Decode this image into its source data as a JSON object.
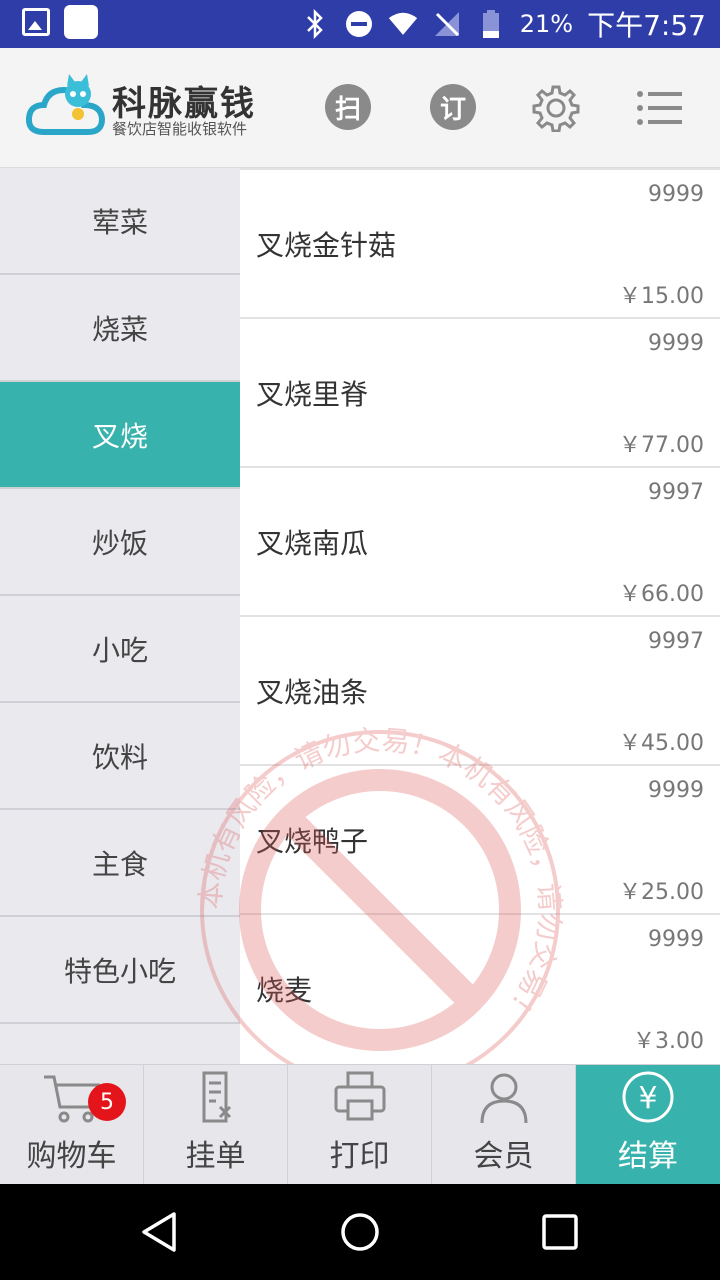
{
  "status_bar": {
    "battery": "21%",
    "time": "下午7:57"
  },
  "header": {
    "brand_name": "科脉赢钱",
    "brand_sub": "餐饮店智能收银软件",
    "scan_label": "扫",
    "order_label": "订"
  },
  "sidebar": {
    "items": [
      {
        "label": "荤菜"
      },
      {
        "label": "烧菜"
      },
      {
        "label": "叉烧"
      },
      {
        "label": "炒饭"
      },
      {
        "label": "小吃"
      },
      {
        "label": "饮料"
      },
      {
        "label": "主食"
      },
      {
        "label": "特色小吃"
      }
    ],
    "active_index": 2
  },
  "dishes": [
    {
      "name": "叉烧金针菇",
      "stock": "9999",
      "price": "￥15.00"
    },
    {
      "name": "叉烧里脊",
      "stock": "9999",
      "price": "￥77.00"
    },
    {
      "name": "叉烧南瓜",
      "stock": "9997",
      "price": "￥66.00"
    },
    {
      "name": "叉烧油条",
      "stock": "9997",
      "price": "￥45.00"
    },
    {
      "name": "叉烧鸭子",
      "stock": "9999",
      "price": "￥25.00"
    },
    {
      "name": "烧麦",
      "stock": "9999",
      "price": "￥3.00"
    }
  ],
  "watermark": {
    "text": "本机有风险，请勿交易！本机有风险，请勿交易！"
  },
  "tabbar": {
    "cart": {
      "label": "购物车",
      "badge": "5"
    },
    "hold": {
      "label": "挂单"
    },
    "print": {
      "label": "打印"
    },
    "member": {
      "label": "会员"
    },
    "checkout": {
      "label": "结算",
      "symbol": "¥"
    }
  },
  "colors": {
    "status_bar": "#2f3da8",
    "accent": "#38b2ac",
    "badge": "#e3151b",
    "stamp": "#e05a5a"
  }
}
